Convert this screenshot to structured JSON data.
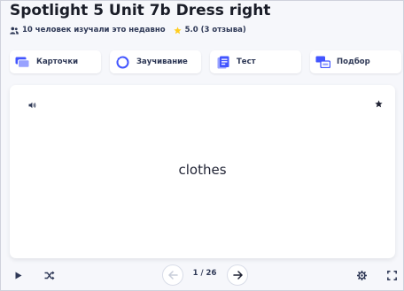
{
  "set": {
    "title": "Spotlight 5 Unit 7b Dress right",
    "learners_text": "10 человек изучали это недавно",
    "rating_text": "5.0 (3 отзыва)"
  },
  "modes": [
    {
      "label": "Карточки",
      "icon": "cards-icon"
    },
    {
      "label": "Заучивание",
      "icon": "learn-icon"
    },
    {
      "label": "Тест",
      "icon": "test-icon"
    },
    {
      "label": "Подбор",
      "icon": "match-icon"
    }
  ],
  "flashcard": {
    "term": "clothes"
  },
  "controls": {
    "counter": "1 / 26"
  },
  "colors": {
    "accent": "#4255ff",
    "star": "#ffcd1f",
    "text": "#2e3856",
    "background": "#f6f7fb"
  }
}
